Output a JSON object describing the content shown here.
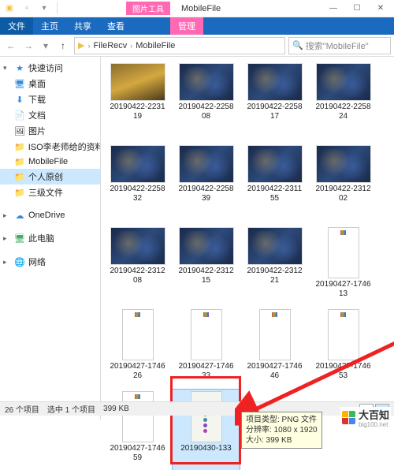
{
  "titlebar": {
    "context_tab": "图片工具",
    "title": "MobileFile"
  },
  "win": {
    "min": "—",
    "max": "☐",
    "close": "✕"
  },
  "menu": {
    "file": "文件",
    "home": "主页",
    "share": "共享",
    "view": "查看",
    "manage": "管理"
  },
  "breadcrumb": {
    "seg1": "FileRecv",
    "seg2": "MobileFile"
  },
  "search": {
    "placeholder": "搜索\"MobileFile\""
  },
  "sidebar": {
    "quick": "快速访问",
    "desktop": "桌面",
    "downloads": "下载",
    "documents": "文档",
    "pictures": "图片",
    "iso": "ISO李老师给的资料",
    "mobilefile": "MobileFile",
    "personal": "个人原创",
    "level3": "三级文件",
    "onedrive": "OneDrive",
    "thispc": "此电脑",
    "network": "网络"
  },
  "files": [
    {
      "name": "20190422-223119",
      "type": "hero"
    },
    {
      "name": "20190422-225808",
      "type": "game"
    },
    {
      "name": "20190422-225817",
      "type": "game"
    },
    {
      "name": "20190422-225824",
      "type": "game"
    },
    {
      "name": "20190422-225832",
      "type": "game"
    },
    {
      "name": "20190422-225839",
      "type": "game"
    },
    {
      "name": "20190422-231155",
      "type": "game"
    },
    {
      "name": "20190422-231202",
      "type": "game"
    },
    {
      "name": "20190422-231208",
      "type": "game"
    },
    {
      "name": "20190422-231215",
      "type": "game"
    },
    {
      "name": "20190422-231221",
      "type": "game"
    },
    {
      "name": "20190427-174613",
      "type": "cal"
    },
    {
      "name": "20190427-174626",
      "type": "cal"
    },
    {
      "name": "20190427-174633",
      "type": "cal"
    },
    {
      "name": "20190427-174646",
      "type": "cal"
    },
    {
      "name": "20190427-174653",
      "type": "cal"
    },
    {
      "name": "20190427-174659",
      "type": "cal"
    },
    {
      "name": "20190430-133",
      "type": "app",
      "selected": true
    }
  ],
  "tooltip": {
    "line1": "项目类型: PNG 文件",
    "line2": "分辨率: 1080 x 1920",
    "line3": "大小: 399 KB"
  },
  "status": {
    "count": "26 个项目",
    "selection": "选中 1 个项目",
    "size": "399 KB"
  },
  "watermark": {
    "text": "大百知",
    "sub": "big100.net"
  }
}
